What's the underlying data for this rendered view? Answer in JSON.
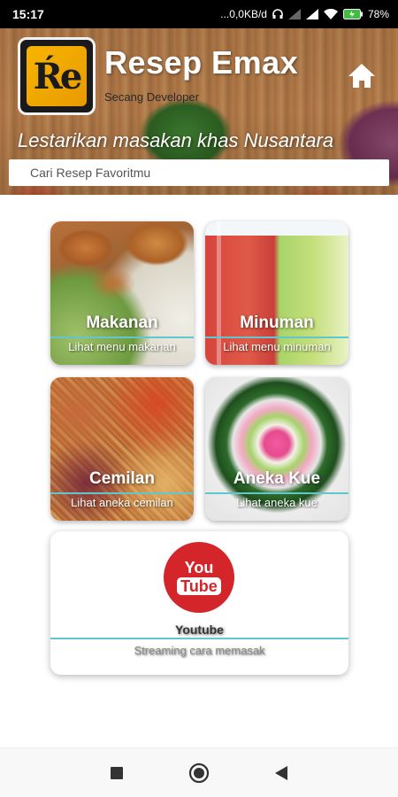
{
  "status_bar": {
    "time": "15:17",
    "network_speed": "...0,0KB/d",
    "battery": "78%"
  },
  "header": {
    "app_title": "Resep Emax",
    "developer": "Secang Developer",
    "tagline": "Lestarikan masakan khas Nusantara",
    "logo_text": "Ŕe",
    "home_icon": "home-icon"
  },
  "search": {
    "placeholder": "Cari Resep Favoritmu",
    "value": ""
  },
  "cards": [
    {
      "title": "Makanan",
      "desc": "Lihat menu makanan"
    },
    {
      "title": "Minuman",
      "desc": "Lihat menu minuman"
    },
    {
      "title": "Cemilan",
      "desc": "Lihat aneka cemilan"
    },
    {
      "title": "Aneka Kue",
      "desc": "Lihat aneka kue"
    }
  ],
  "youtube": {
    "logo_you": "You",
    "logo_tube": "Tube",
    "title": "Youtube",
    "desc": "Streaming cara memasak",
    "brand_color": "#d3252a"
  },
  "colors": {
    "accent_divider": "#5fc7cd"
  },
  "nav": {
    "recents_icon": "square-icon",
    "home_icon": "circle-icon",
    "back_icon": "triangle-back-icon"
  }
}
